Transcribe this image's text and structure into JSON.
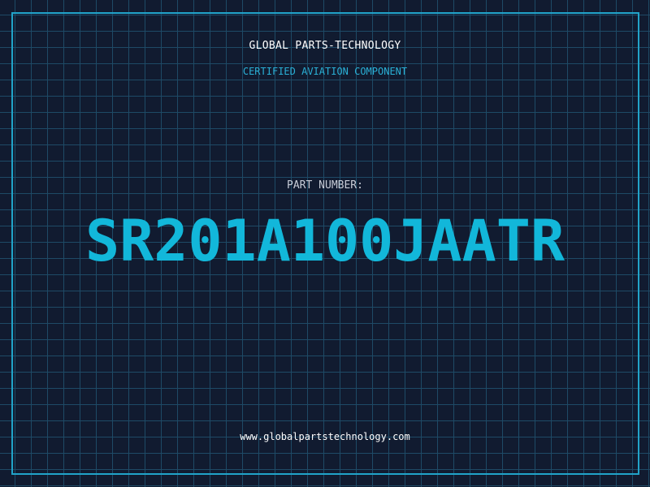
{
  "header": {
    "company": "GLOBAL PARTS-TECHNOLOGY",
    "tagline": "CERTIFIED AVIATION COMPONENT"
  },
  "part": {
    "label": "PART NUMBER:",
    "number": "SR201A100JAATR"
  },
  "footer": {
    "website": "www.globalpartstechnology.com"
  },
  "colors": {
    "background": "#111b30",
    "grid": "#1e4a66",
    "accent": "#12b7da",
    "text": "#ffffff"
  }
}
